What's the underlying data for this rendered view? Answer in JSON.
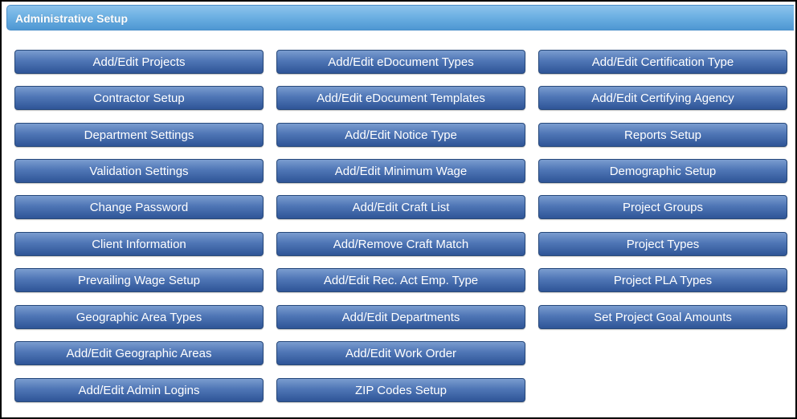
{
  "header": {
    "title": "Administrative Setup"
  },
  "columns": [
    {
      "buttons": [
        "Add/Edit Projects",
        "Contractor Setup",
        "Department Settings",
        "Validation Settings",
        "Change Password",
        "Client Information",
        "Prevailing Wage Setup",
        "Geographic Area Types",
        "Add/Edit Geographic Areas",
        "Add/Edit Admin Logins"
      ]
    },
    {
      "buttons": [
        "Add/Edit eDocument Types",
        "Add/Edit eDocument Templates",
        "Add/Edit Notice Type",
        "Add/Edit Minimum Wage",
        "Add/Edit Craft List",
        "Add/Remove Craft Match",
        "Add/Edit Rec. Act Emp. Type",
        "Add/Edit Departments",
        "Add/Edit Work Order",
        "ZIP Codes Setup"
      ]
    },
    {
      "buttons": [
        "Add/Edit Certification Type",
        "Add/Edit Certifying Agency",
        "Reports Setup",
        "Demographic Setup",
        "Project Groups",
        "Project Types",
        "Project PLA Types",
        "Set Project Goal Amounts"
      ]
    }
  ],
  "colors": {
    "header_bg": "#6eb1e3",
    "button_bg": "#4f76b6",
    "button_text": "#ffffff"
  }
}
